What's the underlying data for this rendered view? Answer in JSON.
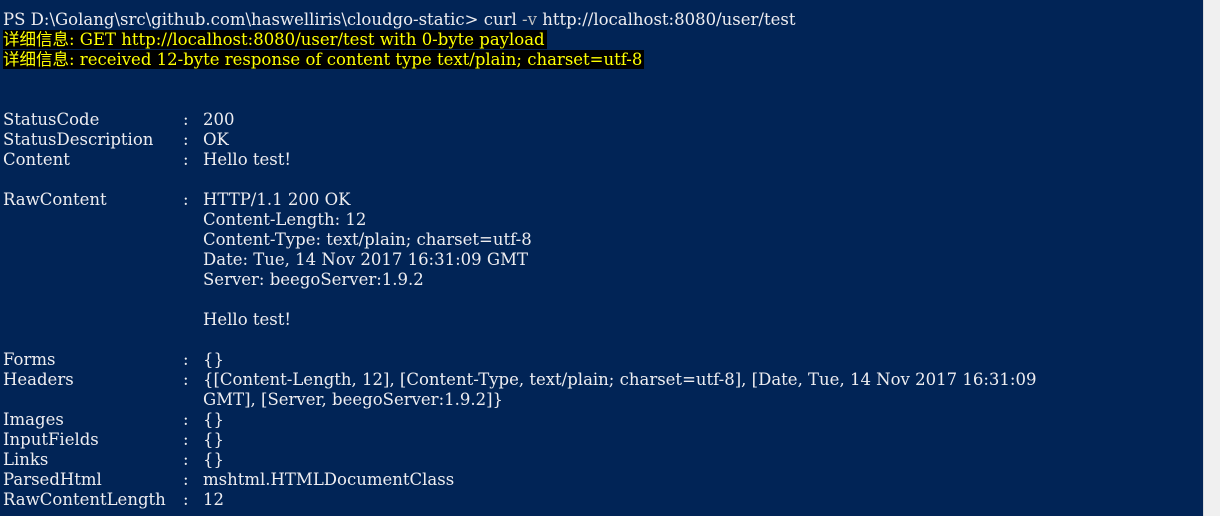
{
  "prompt": {
    "text": "PS D:\\Golang\\src\\github.com\\haswelliris\\cloudgo-static> ",
    "command": "curl",
    "flag": "-v",
    "url": "http://localhost:8080/user/test"
  },
  "verbose": [
    "详细信息: GET http://localhost:8080/user/test with 0-byte payload",
    "详细信息: received 12-byte response of content type text/plain; charset=utf-8"
  ],
  "separator": ": ",
  "fields": {
    "status_code": {
      "name": "StatusCode",
      "value": "200"
    },
    "status_description": {
      "name": "StatusDescription",
      "value": "OK"
    },
    "content": {
      "name": "Content",
      "value": "Hello test!"
    },
    "raw_content": {
      "name": "RawContent",
      "lines": [
        "HTTP/1.1 200 OK",
        "Content-Length: 12",
        "Content-Type: text/plain; charset=utf-8",
        "Date: Tue, 14 Nov 2017 16:31:09 GMT",
        "Server: beegoServer:1.9.2",
        "",
        "Hello test!"
      ]
    },
    "forms": {
      "name": "Forms",
      "value": "{}"
    },
    "headers": {
      "name": "Headers",
      "lines": [
        "{[Content-Length, 12], [Content-Type, text/plain; charset=utf-8], [Date, Tue, 14 Nov 2017 16:31:09",
        "GMT], [Server, beegoServer:1.9.2]}"
      ]
    },
    "images": {
      "name": "Images",
      "value": "{}"
    },
    "input_fields": {
      "name": "InputFields",
      "value": "{}"
    },
    "links": {
      "name": "Links",
      "value": "{}"
    },
    "parsed_html": {
      "name": "ParsedHtml",
      "value": "mshtml.HTMLDocumentClass"
    },
    "raw_content_length": {
      "name": "RawContentLength",
      "value": "12"
    }
  },
  "colors": {
    "background": "#012456",
    "foreground": "#eeedf0",
    "verbose_fg": "#ffff00",
    "verbose_bg": "#000000",
    "arg": "#c0c0c0"
  }
}
